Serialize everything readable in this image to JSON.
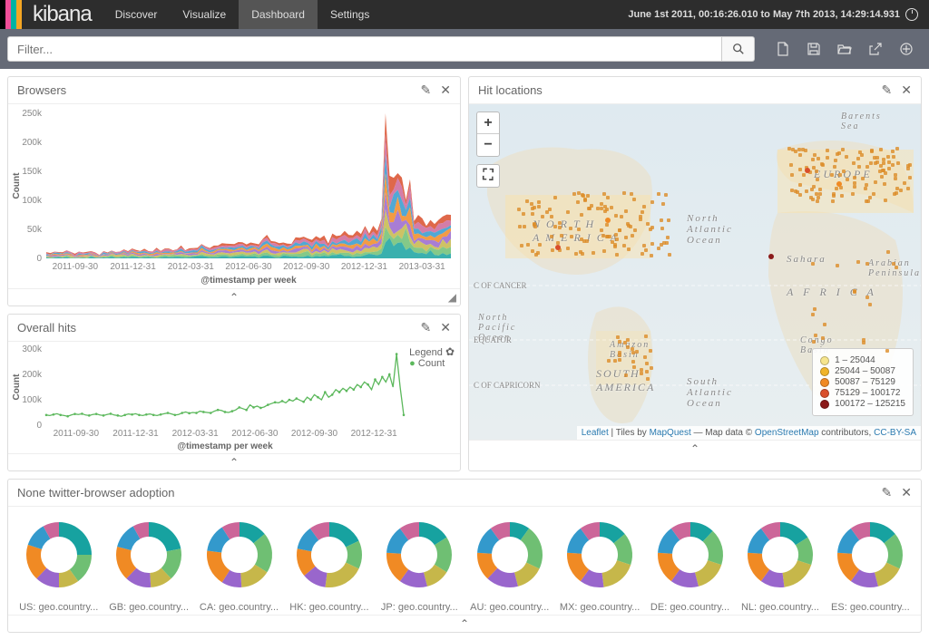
{
  "nav": {
    "tabs": [
      "Discover",
      "Visualize",
      "Dashboard",
      "Settings"
    ],
    "active": 2,
    "timeRange": "June 1st 2011, 00:16:26.010 to May 7th 2013, 14:29:14.931",
    "filterPlaceholder": "Filter..."
  },
  "panels": {
    "browsers": {
      "title": "Browsers"
    },
    "overall": {
      "title": "Overall hits"
    },
    "map": {
      "title": "Hit locations"
    },
    "donuts": {
      "title": "None twitter-browser adoption"
    }
  },
  "map": {
    "legend": [
      {
        "color": "#f6e58d",
        "label": "1 – 25044"
      },
      {
        "color": "#f0b429",
        "label": "25044 – 50087"
      },
      {
        "color": "#f08a24",
        "label": "50087 – 75129"
      },
      {
        "color": "#d94e2a",
        "label": "75129 – 100172"
      },
      {
        "color": "#8b1a1a",
        "label": "100172 – 125215"
      }
    ],
    "labels": {
      "na": "N O R T H\nA M E R I C A",
      "sa": "SOUTH\nAMERICA",
      "eu": "EUROPE",
      "af": "A F R I C A",
      "atl": "North\nAtlantic\nOcean",
      "atl2": "South\nAtlantic\nOcean",
      "pac": "North\nPacific\nOcean",
      "bar": "Barents\nSea",
      "sah": "Sahara",
      "arab": "Arabian\nPeninsula",
      "amaz": "Amazon\nBasin",
      "congo": "Congo\nBasin",
      "cancer": "C OF CANCER",
      "equator": "EQUATOR",
      "capricorn": "C OF CAPRICORN"
    },
    "attrib": {
      "leaflet": "Leaflet",
      "mid1": " | Tiles by ",
      "mapquest": "MapQuest",
      "mid2": " — Map data © ",
      "osm": "OpenStreetMap",
      "mid3": " contributors, ",
      "cc": "CC-BY-SA"
    }
  },
  "donuts": {
    "items": [
      {
        "label": "US: geo.country...",
        "s": [
          25,
          15,
          10,
          12,
          18,
          12,
          8
        ]
      },
      {
        "label": "GB: geo.country...",
        "s": [
          22,
          16,
          11,
          13,
          17,
          13,
          8
        ]
      },
      {
        "label": "CA: geo.country...",
        "s": [
          14,
          20,
          15,
          10,
          18,
          14,
          9
        ]
      },
      {
        "label": "HK: geo.country...",
        "s": [
          18,
          14,
          20,
          12,
          14,
          12,
          10
        ]
      },
      {
        "label": "JP: geo.country...",
        "s": [
          16,
          18,
          12,
          14,
          16,
          14,
          10
        ]
      },
      {
        "label": "AU: geo.country...",
        "s": [
          10,
          22,
          14,
          16,
          14,
          14,
          10
        ]
      },
      {
        "label": "MX: geo.country...",
        "s": [
          14,
          16,
          18,
          12,
          16,
          14,
          10
        ]
      },
      {
        "label": "DE: geo.country...",
        "s": [
          12,
          18,
          16,
          14,
          16,
          14,
          10
        ]
      },
      {
        "label": "NL: geo.country...",
        "s": [
          16,
          14,
          18,
          12,
          16,
          14,
          10
        ]
      },
      {
        "label": "ES: geo.country...",
        "s": [
          14,
          18,
          14,
          14,
          16,
          14,
          10
        ]
      }
    ],
    "palette": [
      "#17a2a0",
      "#6fbf73",
      "#c6b74a",
      "#9966cc",
      "#f08a24",
      "#3399cc",
      "#cc6699"
    ]
  },
  "chart_data": [
    {
      "id": "browsers",
      "type": "area",
      "title": "Browsers",
      "xlabel": "@timestamp per week",
      "ylabel": "Count",
      "ylim": [
        0,
        250000
      ],
      "yticks": [
        0,
        50000,
        100000,
        150000,
        200000,
        250000
      ],
      "ytick_labels": [
        "0",
        "50k",
        "100k",
        "150k",
        "200k",
        "250k"
      ],
      "xticks": [
        "2011-09-30",
        "2011-12-31",
        "2012-03-31",
        "2012-06-30",
        "2012-09-30",
        "2012-12-31",
        "2013-03-31"
      ],
      "stacked": true,
      "series_count": 8,
      "note": "stacked multi-series weekly counts; values rise from ~10k–20k range in 2011 to peaks near ~200k in early 2013"
    },
    {
      "id": "overall",
      "type": "line",
      "title": "Overall hits",
      "xlabel": "@timestamp per week",
      "ylabel": "Count",
      "ylim": [
        0,
        300000
      ],
      "yticks": [
        0,
        100000,
        200000,
        300000
      ],
      "ytick_labels": [
        "0",
        "100k",
        "200k",
        "300k"
      ],
      "xticks": [
        "2011-09-30",
        "2011-12-31",
        "2012-03-31",
        "2012-06-30",
        "2012-09-30",
        "2012-12-31"
      ],
      "series": [
        {
          "name": "Count",
          "x_idx": [
            0,
            1,
            2,
            3,
            4,
            5,
            6,
            7,
            8,
            9,
            10,
            11,
            12,
            13,
            14,
            15,
            16,
            17,
            18,
            19,
            20,
            21,
            22,
            23,
            24,
            25,
            26,
            27,
            28,
            29,
            30,
            31,
            32,
            33,
            34,
            35,
            36,
            37,
            38,
            39,
            40,
            41,
            42,
            43,
            44,
            45,
            46,
            47,
            48,
            49,
            50,
            51,
            52,
            53,
            54,
            55,
            56,
            57,
            58,
            59,
            60,
            61,
            62,
            63,
            64,
            65,
            66,
            67,
            68,
            69,
            70,
            71,
            72,
            73,
            74,
            75,
            76,
            77,
            78,
            79,
            80,
            81,
            82,
            83,
            84,
            85,
            86,
            87,
            88,
            89,
            90,
            91,
            92,
            93,
            94,
            95,
            96,
            97,
            98,
            99,
            100
          ],
          "values": [
            40,
            38,
            42,
            45,
            40,
            38,
            35,
            40,
            44,
            42,
            45,
            40,
            38,
            42,
            44,
            40,
            38,
            42,
            45,
            40,
            38,
            35,
            40,
            44,
            42,
            45,
            40,
            38,
            42,
            44,
            40,
            38,
            42,
            45,
            48,
            44,
            40,
            42,
            48,
            52,
            47,
            50,
            48,
            55,
            52,
            50,
            48,
            55,
            60,
            58,
            52,
            50,
            55,
            60,
            70,
            65,
            60,
            80,
            70,
            75,
            68,
            72,
            80,
            85,
            90,
            88,
            95,
            88,
            100,
            95,
            105,
            98,
            92,
            110,
            100,
            120,
            110,
            100,
            130,
            110,
            120,
            140,
            130,
            145,
            135,
            150,
            140,
            160,
            150,
            170,
            160,
            140,
            180,
            160,
            190,
            170,
            200,
            150,
            280,
            150,
            40
          ],
          "values_unit": "thousand"
        }
      ],
      "legend": "Count",
      "legend_color": "#5cb85c"
    },
    {
      "id": "donuts",
      "type": "pie",
      "title": "None twitter-browser adoption",
      "note": "10 donut charts, one per country code; each shows 7-slice browser share",
      "categories": [
        "US",
        "GB",
        "CA",
        "HK",
        "JP",
        "AU",
        "MX",
        "DE",
        "NL",
        "ES"
      ]
    }
  ]
}
